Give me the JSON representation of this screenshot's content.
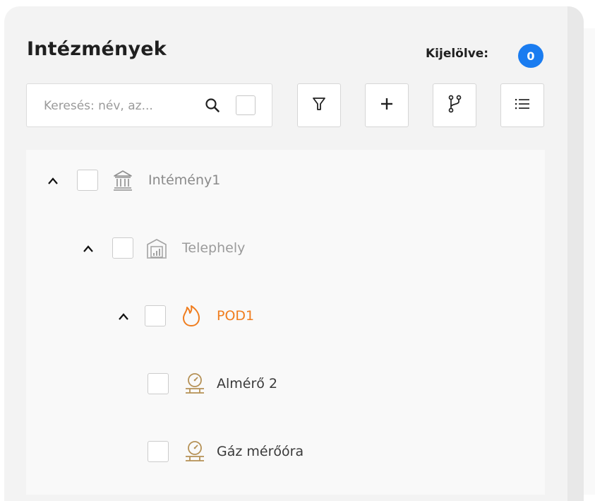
{
  "header": {
    "title": "Intézmények",
    "selected_label": "Kijelölve:",
    "selected_count": "0"
  },
  "search": {
    "placeholder": "Keresés: név, az...",
    "value": ""
  },
  "toolbar": {
    "buttons": [
      {
        "icon": "filter-icon"
      },
      {
        "icon": "plus-icon"
      },
      {
        "icon": "branch-icon"
      },
      {
        "icon": "list-icon"
      }
    ]
  },
  "tree": {
    "nodes": [
      {
        "label": "Intémény1",
        "icon": "institution-icon",
        "expanded": true,
        "color": "#8a8a8a"
      },
      {
        "label": "Telephely",
        "icon": "site-building-icon",
        "expanded": true,
        "color": "#9b9b9b"
      },
      {
        "label": "POD1",
        "icon": "flame-icon",
        "expanded": true,
        "color": "#f07d1e"
      },
      {
        "label": "Almérő 2",
        "icon": "gas-meter-icon",
        "expanded": false,
        "color": "#3a3a3a"
      },
      {
        "label": "Gáz mérőóra",
        "icon": "gas-meter-icon",
        "expanded": false,
        "color": "#3a3a3a"
      }
    ]
  },
  "colors": {
    "accent": "#1a7cf0",
    "pod": "#f07d1e",
    "meter_icon": "#b59156"
  }
}
